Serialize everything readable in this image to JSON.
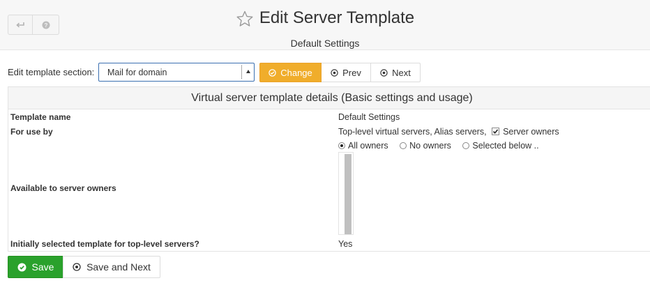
{
  "header": {
    "title": "Edit Server Template",
    "subtitle": "Default Settings",
    "back_icon": "back-arrow-icon",
    "help_icon": "help-circle-icon",
    "favorite_icon": "star-outline-icon"
  },
  "section_selector": {
    "label": "Edit template section:",
    "selected": "Mail for domain",
    "change_label": "Change",
    "prev_label": "Prev",
    "next_label": "Next"
  },
  "panel": {
    "heading": "Virtual server template details (Basic settings and usage)",
    "rows": {
      "template_name": {
        "label": "Template name",
        "value": "Default Settings"
      },
      "for_use_by": {
        "label": "For use by",
        "value_text": "Top-level virtual servers, Alias servers,",
        "server_owners_label": "Server owners",
        "server_owners_checked": true
      },
      "available_to_owners": {
        "label": "Available to server owners",
        "options": [
          "All owners",
          "No owners",
          "Selected below .."
        ],
        "selected_index": 0
      },
      "initially_selected": {
        "label": "Initially selected template for top-level servers?",
        "value": "Yes"
      }
    }
  },
  "footer": {
    "save_label": "Save",
    "save_next_label": "Save and Next"
  },
  "colors": {
    "change_button": "#f0ad2b",
    "save_button": "#2aa12c",
    "select_border": "#3a6fb0"
  }
}
